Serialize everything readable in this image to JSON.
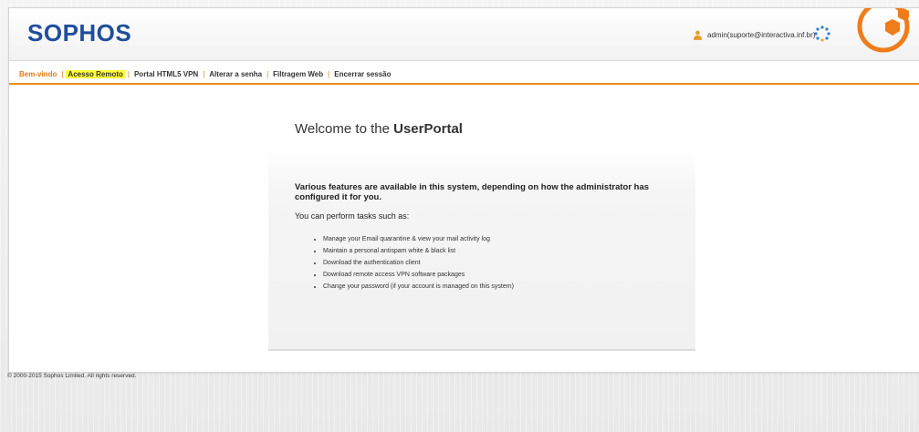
{
  "header": {
    "logo": "SOPHOS",
    "user_label": "admin(suporte@interactiva.inf.br)",
    "icons": [
      "user-icon",
      "loading-spinner-icon",
      "sophos-hex-logo-icon"
    ],
    "colors": {
      "logo": "#1f4e9c",
      "accent": "#f08c1e"
    }
  },
  "nav": {
    "items": [
      "Bem-vindo",
      "Acesso Remoto",
      "Portal HTML5 VPN",
      "Alterar a senha",
      "Filtragem Web",
      "Encerrar sessão"
    ],
    "separator": "|"
  },
  "main": {
    "title_prefix": "Welcome to the ",
    "title_bold": "UserPortal",
    "heading": "Various features are available in this system, depending on how the administrator has configured it for you.",
    "subheading": "You can perform tasks such as:",
    "tasks": [
      "Manage your Email quarantine & view your mail activity log",
      "Maintain a personal antispam white & black list",
      "Download the authentication client",
      "Download remote access VPN software packages",
      "Change your password (if your account is managed on this system)"
    ]
  },
  "footer": {
    "copyright": "© 2000-2015 Sophos Limited. All rights reserved."
  }
}
